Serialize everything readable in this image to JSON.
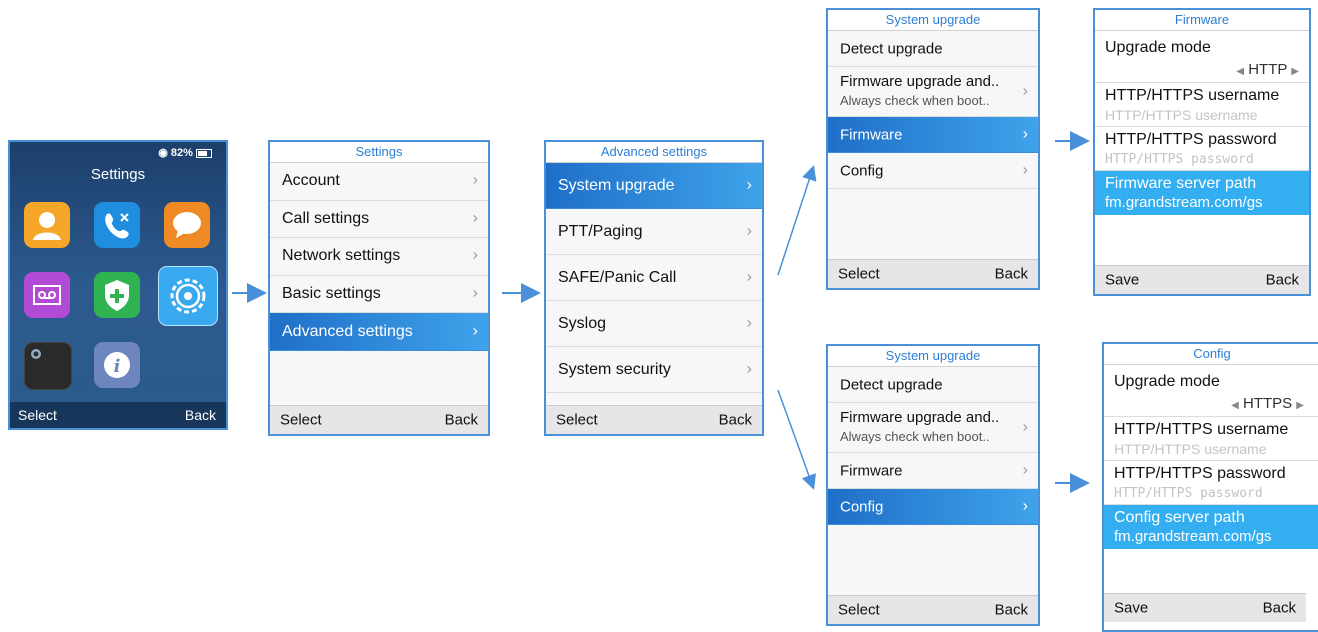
{
  "home": {
    "status_battery": "82%",
    "title": "Settings",
    "soft_left": "Select",
    "soft_right": "Back",
    "apps": [
      {
        "icon": "contacts-icon",
        "color": "#f6a72a"
      },
      {
        "icon": "call-history-icon",
        "color": "#1f8ee0"
      },
      {
        "icon": "messages-icon",
        "color": "#f08a24"
      },
      {
        "icon": "voicemail-icon",
        "color": "#b14bd6"
      },
      {
        "icon": "security-shield-icon",
        "color": "#2fb351"
      },
      {
        "icon": "settings-gear-icon",
        "color": "#39a9ef"
      },
      {
        "icon": "camera-icon",
        "color": "#2a2a2a"
      },
      {
        "icon": "info-icon",
        "color": "#6d86bd"
      }
    ]
  },
  "settings": {
    "title": "Settings",
    "items": [
      "Account",
      "Call settings",
      "Network settings",
      "Basic settings",
      "Advanced settings"
    ],
    "soft_left": "Select",
    "soft_right": "Back"
  },
  "advanced": {
    "title": "Advanced settings",
    "items": [
      "System upgrade",
      "PTT/Paging",
      "SAFE/Panic Call",
      "Syslog",
      "System security"
    ],
    "soft_left": "Select",
    "soft_right": "Back"
  },
  "upgrade_a": {
    "title": "System upgrade",
    "detect": "Detect upgrade",
    "fw_label": "Firmware upgrade and..",
    "fw_sub": "Always check when boot..",
    "firmware": "Firmware",
    "config": "Config",
    "soft_left": "Select",
    "soft_right": "Back"
  },
  "upgrade_b": {
    "title": "System upgrade",
    "detect": "Detect upgrade",
    "fw_label": "Firmware upgrade and..",
    "fw_sub": "Always check when boot..",
    "firmware": "Firmware",
    "config": "Config",
    "soft_left": "Select",
    "soft_right": "Back"
  },
  "firmware": {
    "title": "Firmware",
    "mode_label": "Upgrade mode",
    "mode_value": "HTTP",
    "user_label": "HTTP/HTTPS username",
    "user_placeholder": "HTTP/HTTPS username",
    "pass_label": "HTTP/HTTPS password",
    "pass_placeholder": "HTTP/HTTPS password",
    "path_label": "Firmware server path",
    "path_value": "fm.grandstream.com/gs",
    "soft_left": "Save",
    "soft_right": "Back"
  },
  "config": {
    "title": "Config",
    "mode_label": "Upgrade mode",
    "mode_value": "HTTPS",
    "user_label": "HTTP/HTTPS username",
    "user_placeholder": "HTTP/HTTPS username",
    "pass_label": "HTTP/HTTPS password",
    "pass_placeholder": "HTTP/HTTPS password",
    "path_label": "Config server path",
    "path_value": "fm.grandstream.com/gs",
    "soft_left": "Save",
    "soft_right": "Back"
  },
  "colors": {
    "accent": "#2b7fd4",
    "selected": "#33aef0",
    "arrow": "#4a90d9"
  }
}
